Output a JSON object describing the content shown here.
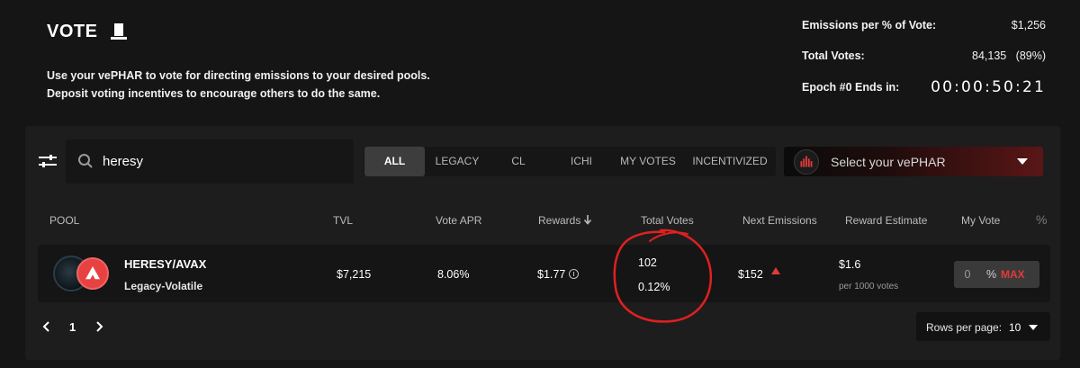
{
  "header": {
    "title": "VOTE",
    "hat_icon": "top-hat-icon",
    "desc_line1": "Use your vePHAR to vote for directing emissions to your desired pools.",
    "desc_line2": "Deposit voting incentives to encourage others to do the same."
  },
  "stats": {
    "emissions_label": "Emissions per % of Vote:",
    "emissions_value": "$1,256",
    "total_votes_label": "Total Votes:",
    "total_votes_value": "84,135   (89%)",
    "epoch_label": "Epoch #0 Ends in:",
    "epoch_timer": "00:00:50:21"
  },
  "search": {
    "value": "heresy",
    "placeholder": "Search"
  },
  "tabs": [
    "ALL",
    "LEGACY",
    "CL",
    "ICHI",
    "MY VOTES",
    "INCENTIVIZED"
  ],
  "active_tab": "ALL",
  "ve_select": {
    "label": "Select your vePHAR"
  },
  "table": {
    "headers": {
      "pool": "POOL",
      "tvl": "TVL",
      "vote_apr": "Vote APR",
      "rewards": "Rewards",
      "total_votes": "Total Votes",
      "next_emissions": "Next Emissions",
      "reward_estimate": "Reward Estimate",
      "my_vote": "My Vote",
      "pct": "%"
    },
    "rows": [
      {
        "pair": "HERESY/AVAX",
        "type": "Legacy-Volatile",
        "tvl": "$7,215",
        "vote_apr": "8.06%",
        "rewards": "$1.77",
        "total_votes": "102",
        "total_votes_pct": "0.12%",
        "next_emissions": "$152",
        "reward_estimate": "$1.6",
        "reward_estimate_sub": "per 1000 votes",
        "my_vote_value": "0",
        "pct_sign": "%",
        "max_label": "MAX"
      }
    ]
  },
  "pagination": {
    "page": "1",
    "rows_label": "Rows per page:",
    "rows_value": "10"
  },
  "colors": {
    "accent": "#e03a3a",
    "background": "#151515",
    "panel": "#1d1d1d",
    "annotation": "#e02020"
  }
}
